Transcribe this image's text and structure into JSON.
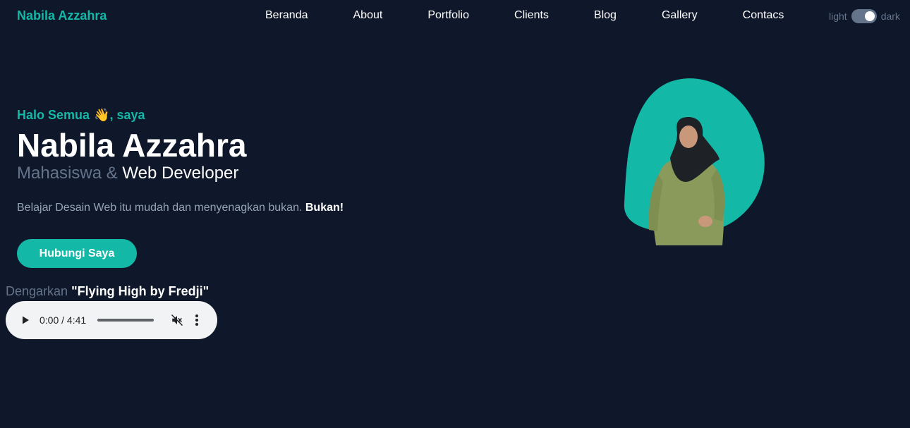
{
  "header": {
    "brand": "Nabila Azzahra",
    "nav": [
      {
        "label": "Beranda"
      },
      {
        "label": "About"
      },
      {
        "label": "Portfolio"
      },
      {
        "label": "Clients"
      },
      {
        "label": "Blog"
      },
      {
        "label": "Gallery"
      },
      {
        "label": "Contacs"
      }
    ],
    "theme_toggle": {
      "light_label": "light",
      "dark_label": "dark",
      "state": "dark"
    }
  },
  "hero": {
    "greeting": "Halo Semua",
    "greeting_emoji": "👋",
    "greeting_suffix": ", saya",
    "name": "Nabila Azzahra",
    "role_prefix": "Mahasiswa &",
    "role_highlight": "Web Developer",
    "tagline": "Belajar Desain Web itu mudah dan menyenagkan bukan.",
    "tagline_bold": "Bukan!",
    "cta_label": "Hubungi Saya"
  },
  "audio": {
    "label_prefix": "Dengarkan",
    "track": "\"Flying High by Fredji\"",
    "time": "0:00 / 4:41",
    "muted": true
  },
  "colors": {
    "background": "#0f172a",
    "accent": "#14b8a6",
    "muted_text": "#64748b"
  },
  "icons": [
    "play-icon",
    "volume-muted-icon",
    "more-vert-icon",
    "waving-hand-icon"
  ]
}
